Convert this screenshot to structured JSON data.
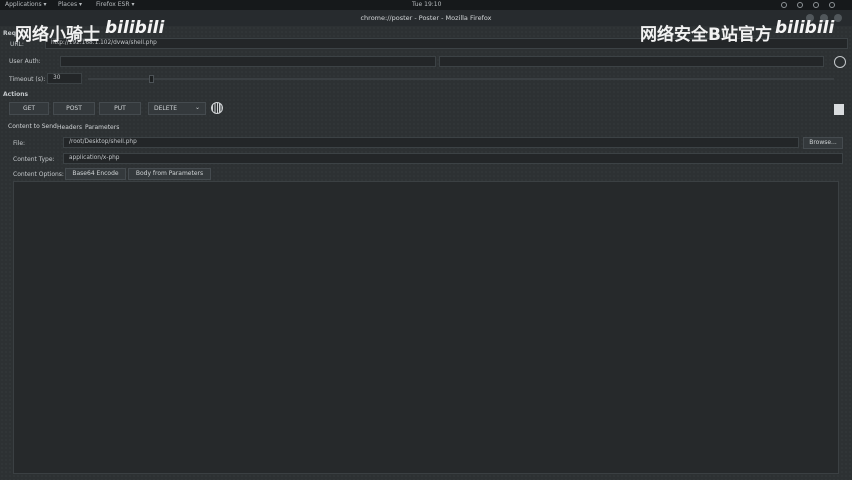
{
  "system_bar": {
    "applications": "Applications ▾",
    "places": "Places ▾",
    "browser": "Firefox ESR ▾",
    "clock": "Tue 19:10"
  },
  "window": {
    "title": "chrome://poster - Poster - Mozilla Firefox"
  },
  "watermarks": {
    "left_text": "网络小骑士",
    "left_logo": "bilibili",
    "right_text": "网络安全B站官方",
    "right_logo": "bilibili"
  },
  "request": {
    "section_label": "Req",
    "url_label": "URL:",
    "url_value": "http://192.168.1.102/dvwa/shell.php",
    "user_auth_label": "User Auth:",
    "user_value": "",
    "password_value": "",
    "timeout_label": "Timeout (s):",
    "timeout_value": "30"
  },
  "actions": {
    "label": "Actions",
    "get": "GET",
    "post": "POST",
    "put": "PUT",
    "select_value": "DELETE",
    "select_arrow": "⌄"
  },
  "tabs": {
    "content_to_send": "Content to Send",
    "headers": "Headers",
    "parameters": "Parameters"
  },
  "content": {
    "file_label": "File:",
    "file_value": "/root/Desktop/shell.php",
    "browse": "Browse...",
    "content_type_label": "Content Type:",
    "content_type_value": "application/x-php",
    "options_label": "Content Options:",
    "base64": "Base64 Encode",
    "body_from_params": "Body from Parameters",
    "body_text": ""
  }
}
